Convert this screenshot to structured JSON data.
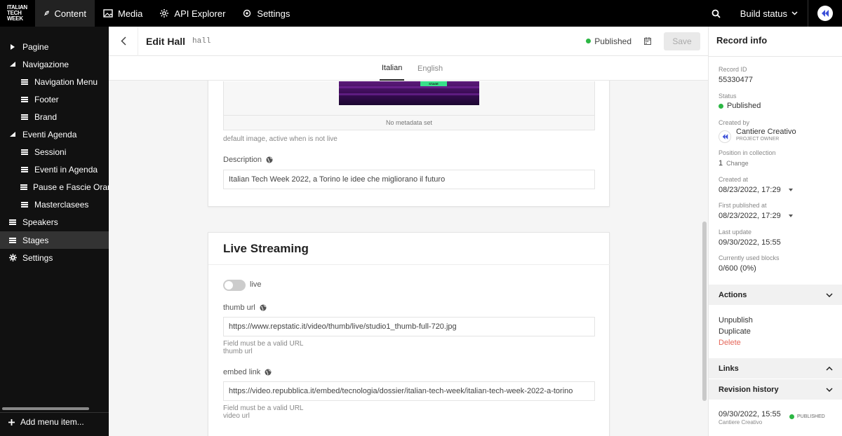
{
  "topbar": {
    "logo_lines": [
      "ITALIAN",
      "TECH",
      "WEEK"
    ],
    "nav": [
      {
        "label": "Content",
        "icon": "feather-icon",
        "active": true
      },
      {
        "label": "Media",
        "icon": "image-icon",
        "active": false
      },
      {
        "label": "API Explorer",
        "icon": "gear-icon",
        "active": false
      },
      {
        "label": "Settings",
        "icon": "settings-icon",
        "active": false
      }
    ],
    "build_status": "Build status"
  },
  "sidebar": {
    "items": [
      {
        "label": "Pagine",
        "type": "group-collapsed"
      },
      {
        "label": "Navigazione",
        "type": "group-expanded"
      },
      {
        "label": "Navigation Menu",
        "type": "model"
      },
      {
        "label": "Footer",
        "type": "model"
      },
      {
        "label": "Brand",
        "type": "model"
      },
      {
        "label": "Eventi Agenda",
        "type": "group-expanded"
      },
      {
        "label": "Sessioni",
        "type": "model"
      },
      {
        "label": "Eventi in Agenda",
        "type": "model"
      },
      {
        "label": "Pause e Fascie Orarie",
        "type": "model"
      },
      {
        "label": "Masterclasees",
        "type": "model"
      },
      {
        "label": "Speakers",
        "type": "model"
      },
      {
        "label": "Stages",
        "type": "model",
        "active": true
      },
      {
        "label": "Settings",
        "type": "settings"
      }
    ],
    "add_menu_item": "Add menu item..."
  },
  "header": {
    "title": "Edit Hall",
    "model_key": "hall",
    "status": "Published",
    "save_label": "Save"
  },
  "lang_tabs": [
    {
      "label": "Italian",
      "active": true
    },
    {
      "label": "English",
      "active": false
    }
  ],
  "media_card": {
    "image_badge": "STAGE",
    "no_metadata": "No metadata set",
    "image_hint": "default image, active when is not live",
    "description_label": "Description",
    "description_value": "Italian Tech Week 2022, a Torino le idee che migliorano il futuro"
  },
  "live_card": {
    "title": "Live Streaming",
    "toggle_label": "live",
    "toggle_on": false,
    "thumb_label": "thumb url",
    "thumb_value": "https://www.repstatic.it/video/thumb/live/studio1_thumb-full-720.jpg",
    "thumb_hint_1": "Field must be a valid URL",
    "thumb_hint_2": "thumb url",
    "embed_label": "embed link",
    "embed_value": "https://video.repubblica.it/embed/tecnologia/dossier/italian-tech-week/italian-tech-week-2022-a-torino",
    "embed_hint_1": "Field must be a valid URL",
    "embed_hint_2": "video url"
  },
  "record_info": {
    "title": "Record info",
    "record_id_label": "Record ID",
    "record_id": "55330477",
    "status_label": "Status",
    "status": "Published",
    "created_by_label": "Created by",
    "creator_name": "Cantiere Creativo",
    "creator_role": "PROJECT OWNER",
    "position_label": "Position in collection",
    "position_value": "1",
    "position_change": "Change",
    "created_at_label": "Created at",
    "created_at": "08/23/2022, 17:29",
    "first_published_label": "First published at",
    "first_published": "08/23/2022, 17:29",
    "last_update_label": "Last update",
    "last_update": "09/30/2022, 15:55",
    "blocks_label": "Currently used blocks",
    "blocks_value": "0/600 (0%)",
    "actions_title": "Actions",
    "actions": [
      "Unpublish",
      "Duplicate",
      "Delete"
    ],
    "links_title": "Links",
    "revision_title": "Revision history",
    "revision_date": "09/30/2022, 15:55",
    "revision_author": "Cantiere Creativo",
    "revision_status": "PUBLISHED"
  },
  "colors": {
    "topbar_bg": "#000000",
    "sidebar_bg": "#111111",
    "published_green": "#2cb744",
    "delete_red": "#e5675a",
    "brand_blue": "#3b4fd8"
  }
}
